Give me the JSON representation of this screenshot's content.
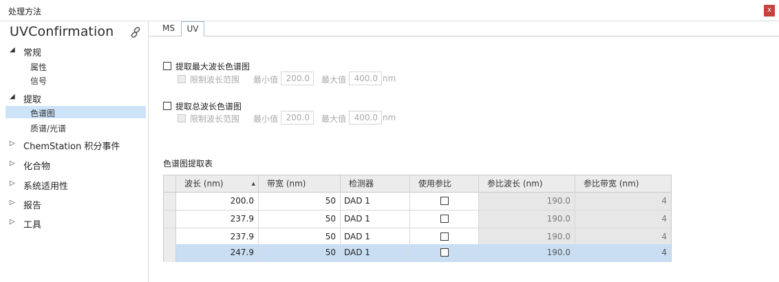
{
  "window": {
    "title": "处理方法",
    "close_label": "x"
  },
  "method": {
    "name": "UVConfirmation"
  },
  "tree": {
    "general": {
      "label": "常规",
      "children": [
        "属性",
        "信号"
      ]
    },
    "extract": {
      "label": "提取",
      "children": [
        "色谱图",
        "质谱/光谱"
      ]
    },
    "chemstation": {
      "label": "ChemStation 积分事件"
    },
    "compounds": {
      "label": "化合物"
    },
    "suitability": {
      "label": "系统适用性"
    },
    "report": {
      "label": "报告"
    },
    "tools": {
      "label": "工具"
    }
  },
  "tabs": [
    "MS",
    "UV"
  ],
  "max_wavelength": {
    "label": "提取最大波长色谱图",
    "limit_label": "限制波长范围",
    "min_label": "最小值",
    "min_value": "200.0",
    "max_label": "最大值",
    "max_value": "400.0",
    "unit": "nm"
  },
  "total_wavelength": {
    "label": "提取总波长色谱图",
    "limit_label": "限制波长范围",
    "min_label": "最小值",
    "min_value": "200.0",
    "max_label": "最大值",
    "max_value": "400.0",
    "unit": "nm"
  },
  "table": {
    "title": "色谱图提取表",
    "columns": [
      "波长 (nm)",
      "带宽 (nm)",
      "检测器",
      "使用参比",
      "参比波长 (nm)",
      "参比带宽 (nm)"
    ],
    "rows": [
      {
        "wavelength": "200.0",
        "bandwidth": "50",
        "detector": "DAD 1",
        "ref_wavelength": "190.0",
        "ref_bandwidth": "4"
      },
      {
        "wavelength": "237.9",
        "bandwidth": "50",
        "detector": "DAD 1",
        "ref_wavelength": "190.0",
        "ref_bandwidth": "4"
      },
      {
        "wavelength": "237.9",
        "bandwidth": "50",
        "detector": "DAD 1",
        "ref_wavelength": "190.0",
        "ref_bandwidth": "4"
      },
      {
        "wavelength": "247.9",
        "bandwidth": "50",
        "detector": "DAD 1",
        "ref_wavelength": "190.0",
        "ref_bandwidth": "4"
      }
    ]
  },
  "colors": {
    "selection": "#cde3f7",
    "close": "#c8413c",
    "tab_border": "#9bbfe0"
  }
}
